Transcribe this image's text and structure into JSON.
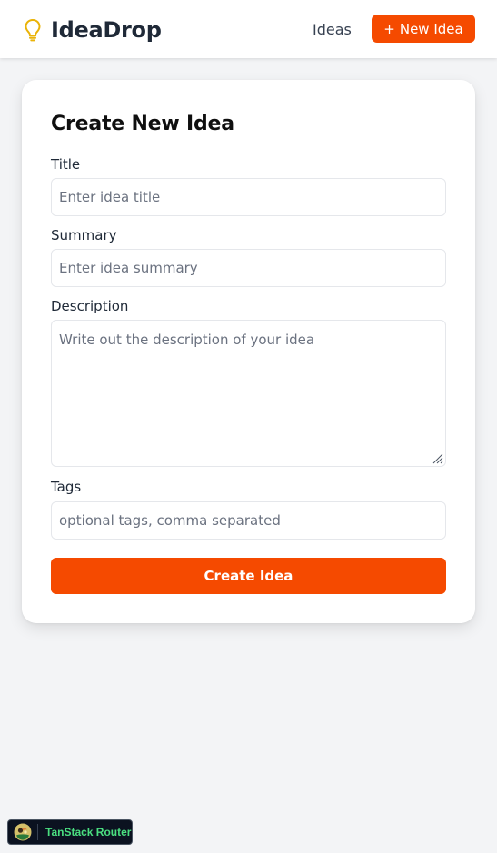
{
  "navbar": {
    "brand_icon": "lightbulb-icon",
    "brand_icon_color": "#eab308",
    "brand_name": "IdeaDrop",
    "link_ideas": "Ideas",
    "new_idea_icon": "plus-icon",
    "new_idea_plus": "+",
    "new_idea_label": "New Idea"
  },
  "form": {
    "title": "Create New Idea",
    "fields": {
      "title": {
        "label": "Title",
        "placeholder": "Enter idea title",
        "value": ""
      },
      "summary": {
        "label": "Summary",
        "placeholder": "Enter idea summary",
        "value": ""
      },
      "description": {
        "label": "Description",
        "placeholder": "Write out the description of your idea",
        "value": ""
      },
      "tags": {
        "label": "Tags",
        "placeholder": "optional tags, comma separated",
        "value": ""
      }
    },
    "submit_label": "Create Idea"
  },
  "devtools": {
    "logo_icon": "tanstack-logo-icon",
    "label": "TanStack Router"
  },
  "colors": {
    "accent": "#f54a00",
    "page_background": "#f3f4f6",
    "card_background": "#ffffff",
    "devtools_text": "#4ade80"
  }
}
